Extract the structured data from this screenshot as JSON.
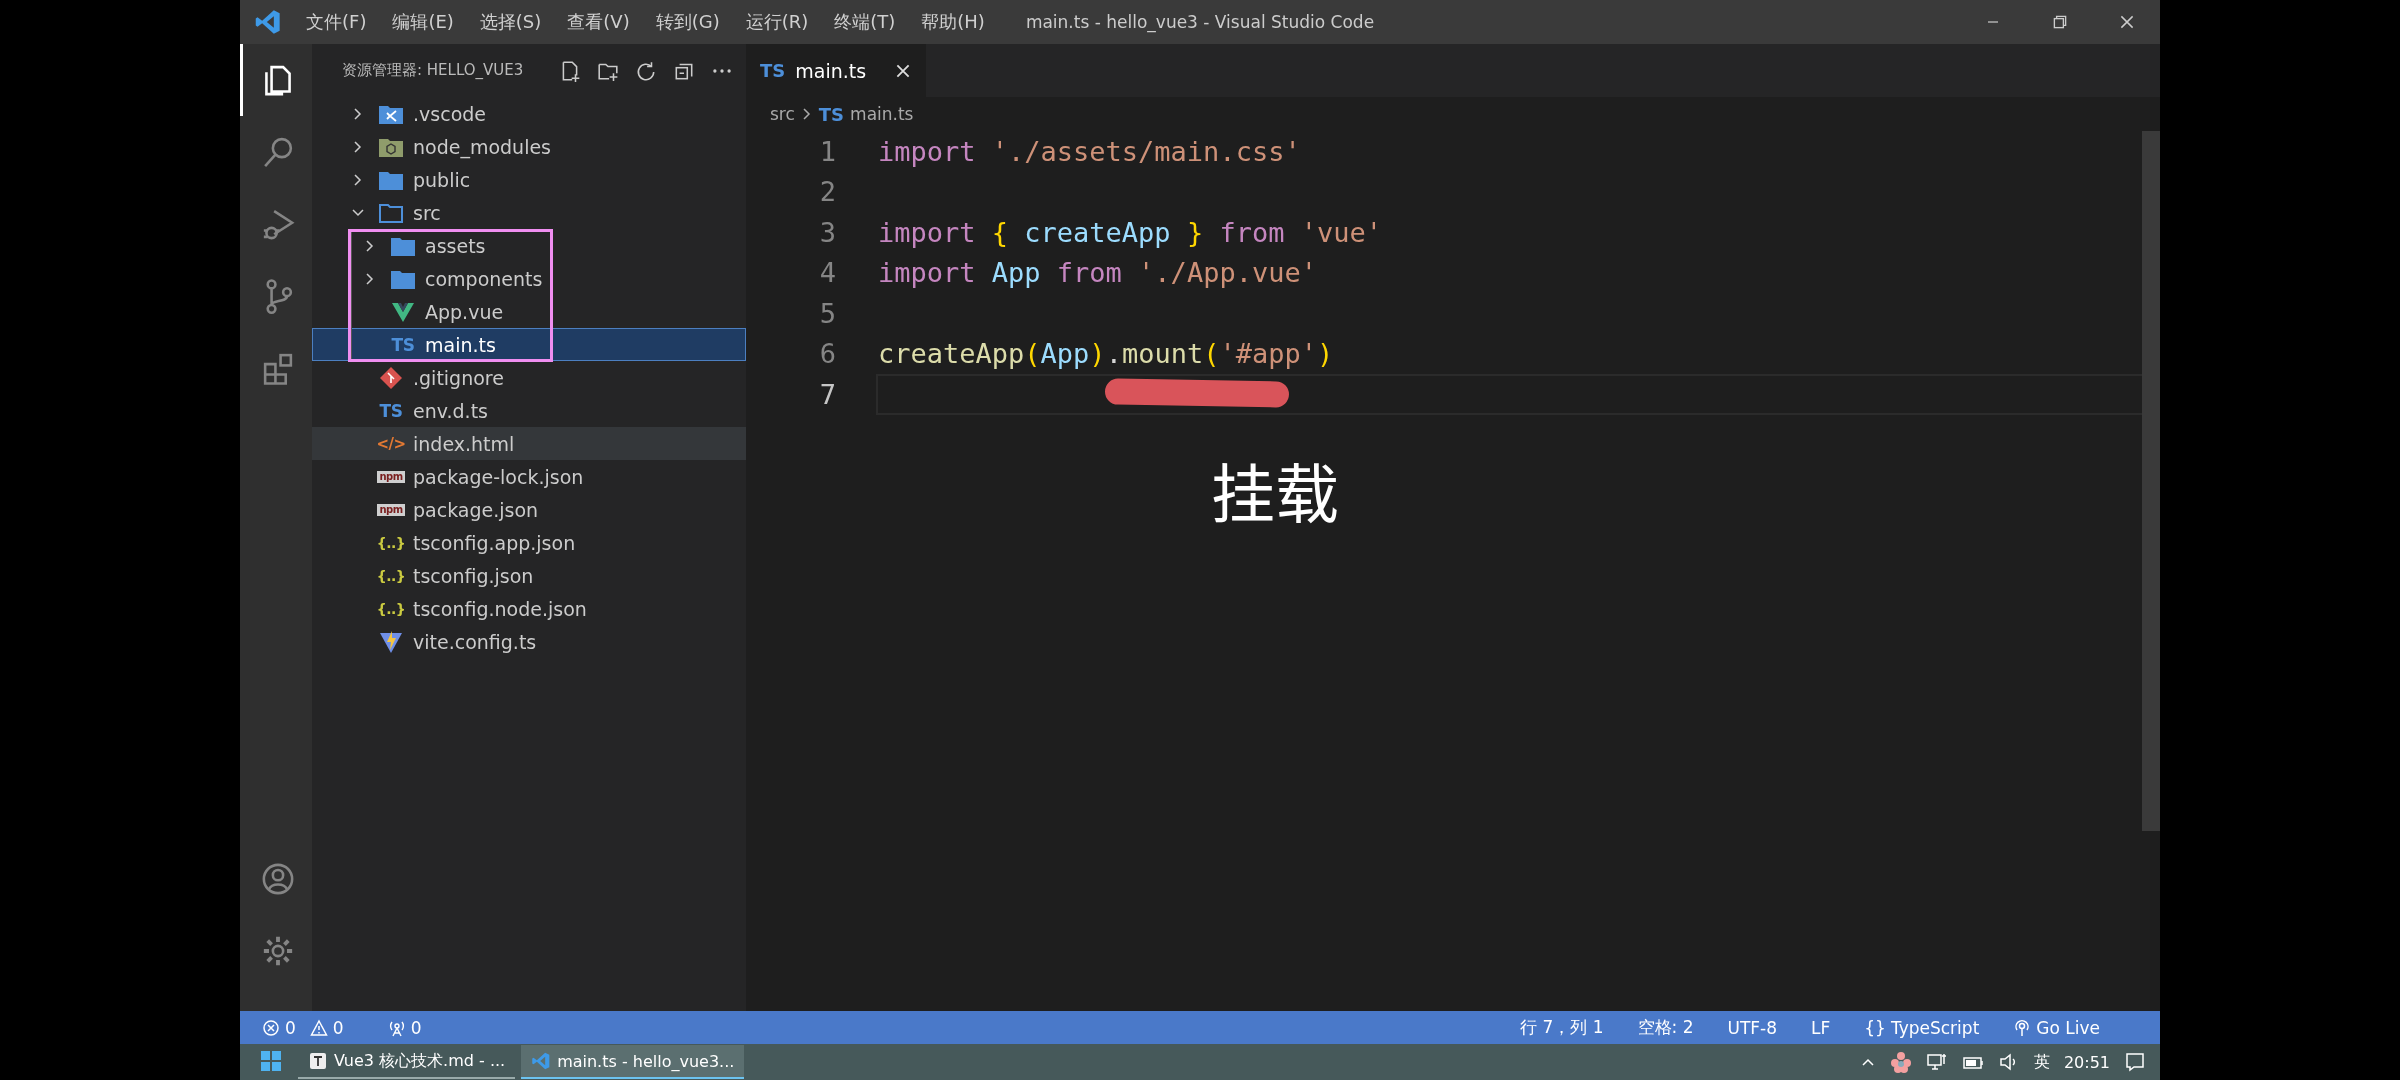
{
  "window": {
    "title": "main.ts - hello_vue3 - Visual Studio Code"
  },
  "menu": [
    "文件(F)",
    "编辑(E)",
    "选择(S)",
    "查看(V)",
    "转到(G)",
    "运行(R)",
    "终端(T)",
    "帮助(H)"
  ],
  "activity_bar": {
    "top": [
      {
        "kind": "explorer",
        "selected": true
      },
      {
        "kind": "search",
        "selected": false
      },
      {
        "kind": "debug",
        "selected": false
      },
      {
        "kind": "scm",
        "selected": false
      },
      {
        "kind": "extensions",
        "selected": false
      }
    ],
    "bottom": [
      {
        "kind": "accounts"
      },
      {
        "kind": "manage"
      }
    ]
  },
  "explorer": {
    "title": "资源管理器: HELLO_VUE3",
    "tree": [
      {
        "name": ".vscode",
        "kind": "folder-vscode",
        "expanded": false,
        "selected": false,
        "hovered": false
      },
      {
        "name": "node_modules",
        "kind": "folder-node",
        "expanded": false,
        "selected": false,
        "hovered": false
      },
      {
        "name": "public",
        "kind": "folder",
        "expanded": false,
        "selected": false,
        "hovered": false
      },
      {
        "name": "src",
        "kind": "folder",
        "expanded": true,
        "selected": false,
        "hovered": false,
        "children": [
          {
            "name": "assets",
            "kind": "folder",
            "expanded": false,
            "selected": false,
            "hovered": false
          },
          {
            "name": "components",
            "kind": "folder",
            "expanded": false,
            "selected": false,
            "hovered": false
          },
          {
            "name": "App.vue",
            "kind": "vue",
            "selected": false,
            "hovered": false
          },
          {
            "name": "main.ts",
            "kind": "ts",
            "badge": "TS",
            "selected": true,
            "hovered": false
          }
        ]
      },
      {
        "name": ".gitignore",
        "kind": "git",
        "selected": false,
        "hovered": false
      },
      {
        "name": "env.d.ts",
        "kind": "ts",
        "badge": "TS",
        "selected": false,
        "hovered": false
      },
      {
        "name": "index.html",
        "kind": "html",
        "badge": "</>",
        "selected": false,
        "hovered": true
      },
      {
        "name": "package-lock.json",
        "kind": "npm",
        "badge": "npm",
        "selected": false,
        "hovered": false
      },
      {
        "name": "package.json",
        "kind": "npm",
        "badge": "npm",
        "selected": false,
        "hovered": false
      },
      {
        "name": "tsconfig.app.json",
        "kind": "json",
        "badge": "{..}",
        "selected": false,
        "hovered": false
      },
      {
        "name": "tsconfig.json",
        "kind": "json",
        "badge": "{..}",
        "selected": false,
        "hovered": false
      },
      {
        "name": "tsconfig.node.json",
        "kind": "json",
        "badge": "{..}",
        "selected": false,
        "hovered": false
      },
      {
        "name": "vite.config.ts",
        "kind": "vite",
        "selected": false,
        "hovered": false
      }
    ]
  },
  "editor": {
    "tabs": [
      {
        "badge": "TS",
        "label": "main.ts",
        "selected": true
      }
    ],
    "breadcrumb": {
      "folder": "src",
      "badge": "TS",
      "file": "main.ts"
    },
    "lines": [
      {
        "number": "1",
        "current": false,
        "tokens": [
          {
            "kind": "keyword",
            "text": "import "
          },
          {
            "kind": "string",
            "text": "'./assets/main.css'"
          }
        ]
      },
      {
        "number": "2",
        "current": false
      },
      {
        "number": "3",
        "current": false,
        "tokens": [
          {
            "kind": "keyword",
            "text": "import "
          },
          {
            "kind": "bracket",
            "text": "{ "
          },
          {
            "kind": "variable",
            "text": "createApp "
          },
          {
            "kind": "bracket",
            "text": "} "
          },
          {
            "kind": "keyword",
            "text": "from "
          },
          {
            "kind": "string",
            "text": "'vue'"
          }
        ]
      },
      {
        "number": "4",
        "current": false,
        "tokens": [
          {
            "kind": "keyword",
            "text": "import "
          },
          {
            "kind": "variable",
            "text": "App "
          },
          {
            "kind": "keyword",
            "text": "from "
          },
          {
            "kind": "string",
            "text": "'./App.vue'"
          }
        ]
      },
      {
        "number": "5",
        "current": false
      },
      {
        "number": "6",
        "current": false,
        "tokens": [
          {
            "kind": "function",
            "text": "createApp"
          },
          {
            "kind": "bracket",
            "text": "("
          },
          {
            "kind": "variable",
            "text": "App"
          },
          {
            "kind": "bracket",
            "text": ")"
          },
          {
            "kind": "plain",
            "text": "."
          },
          {
            "kind": "function",
            "text": "mount"
          },
          {
            "kind": "bracket",
            "text": "("
          },
          {
            "kind": "string",
            "text": "'#app'"
          },
          {
            "kind": "bracket",
            "text": ")"
          }
        ]
      },
      {
        "number": "7",
        "current": true
      }
    ],
    "caption": "挂载"
  },
  "status_bar": {
    "left": [
      {
        "kind": "errors",
        "text": "0"
      },
      {
        "kind": "warnings",
        "text": "0"
      },
      {
        "kind": "ports",
        "text": "0"
      }
    ],
    "right": [
      {
        "kind": "text",
        "text": "行 7，列 1"
      },
      {
        "kind": "text",
        "text": "空格: 2"
      },
      {
        "kind": "text",
        "text": "UTF-8"
      },
      {
        "kind": "text",
        "text": "LF"
      },
      {
        "kind": "language",
        "icon": "{}",
        "text": "TypeScript"
      },
      {
        "kind": "live",
        "text": "Go Live"
      }
    ]
  },
  "taskbar": {
    "items": [
      {
        "kind": "markdown",
        "label": "Vue3 核心技术.md - ...",
        "selected": false
      },
      {
        "kind": "vscode",
        "label": "main.ts - hello_vue3...",
        "selected": true
      }
    ],
    "tray": {
      "ime": "英",
      "time": "20:51"
    }
  }
}
